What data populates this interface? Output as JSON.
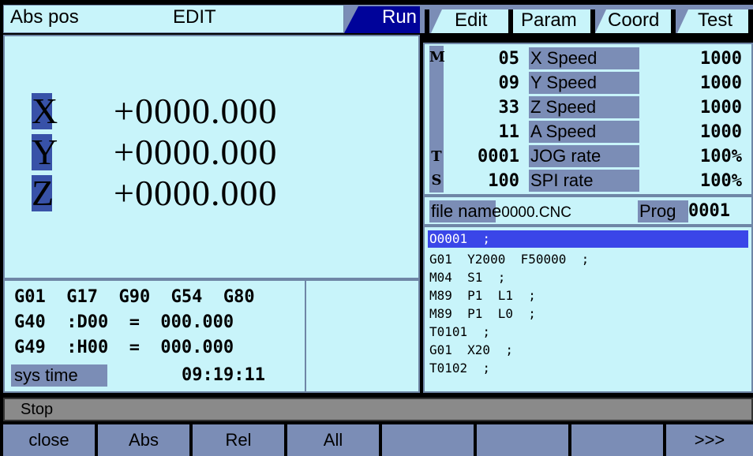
{
  "topbar": {
    "mode": "Abs pos",
    "state": "EDIT",
    "tabs": [
      {
        "label": "Run",
        "active": true
      },
      {
        "label": "Edit",
        "active": false
      },
      {
        "label": "Param",
        "active": false
      },
      {
        "label": "Coord",
        "active": false
      },
      {
        "label": "Test",
        "active": false
      }
    ]
  },
  "axes": [
    {
      "letter": "X",
      "value": "+0000.000"
    },
    {
      "letter": "Y",
      "value": "+0000.000"
    },
    {
      "letter": "Z",
      "value": "+0000.000"
    }
  ],
  "modal": {
    "line1": "G01  G17  G90  G54  G80",
    "line2": "G40  :D00  =  000.000",
    "line3": "G49  :H00  =  000.000",
    "systime_label": "sys time",
    "systime_value": "09:19:11"
  },
  "codes": {
    "letters": {
      "m": "M",
      "t": "T",
      "s": "S"
    },
    "m_values": [
      "05",
      "09",
      "33",
      "11"
    ],
    "t_value": "0001",
    "s_value": "100"
  },
  "speeds": [
    {
      "label": "X Speed",
      "value": "1000"
    },
    {
      "label": "Y Speed",
      "value": "1000"
    },
    {
      "label": "Z Speed",
      "value": "1000"
    },
    {
      "label": "A Speed",
      "value": "1000"
    },
    {
      "label": "JOG rate",
      "value": "100%"
    },
    {
      "label": "SPI rate",
      "value": "100%"
    }
  ],
  "file": {
    "label": "file name",
    "name": "0000.CNC",
    "prog_label": "Prog",
    "prog_value": "0001"
  },
  "program_lines": [
    "O0001  ;",
    "G01  Y2000  F50000  ;",
    "M04  S1  ;",
    "M89  P1  L1  ;",
    "M89  P1  L0  ;",
    "T0101  ;",
    "G01  X20  ;",
    "T0102  ;"
  ],
  "status": "Stop",
  "softkeys": [
    "close",
    "Abs",
    "Rel",
    "All",
    "",
    "",
    "",
    ">>>"
  ]
}
